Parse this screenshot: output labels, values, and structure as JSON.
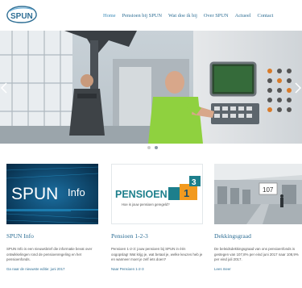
{
  "brand": {
    "logo_text": "SPUN"
  },
  "nav": {
    "items": [
      {
        "label": "Home",
        "active": true
      },
      {
        "label": "Pensioen bij SPUN",
        "active": false
      },
      {
        "label": "Wat doe ik bij",
        "active": false
      },
      {
        "label": "Over SPUN",
        "active": false
      },
      {
        "label": "Actueel",
        "active": false
      },
      {
        "label": "Contact",
        "active": false
      }
    ]
  },
  "slider": {
    "slides": 2,
    "active": 2
  },
  "cards": [
    {
      "title": "SPUN Info",
      "thumb_text": {
        "left": "SPUN",
        "right": "Info"
      },
      "body": "SPUN Info is een nieuwsbrief die informatie bevat over ontwikkelingen rond de pensioenregeling en het pensioenfonds.",
      "link": "Ga naar de nieuwste editie: juni 2017"
    },
    {
      "title": "Pensioen 1-2-3",
      "thumb_text": {
        "word": "PENSIOEN",
        "n1": "1",
        "n3": "3",
        "sub": "Hoe is jouw pensioen geregeld?"
      },
      "body": "Pensioen 1-2-3: jouw pensioen bij SPUN in één oogopslag! Wat krijg je, wat betaal je, welke keuzes heb je en wanneer moet je zelf iets doen?",
      "link": "Naar Pensioen 1-2-3"
    },
    {
      "title": "Dekkingsgraad",
      "thumb_text": {
        "sign": "107"
      },
      "body": "De beleidsdekkingsgraad van ons pensioenfonds is gestegen van 107,8% per eind juni 2017 naar 108,9% per eind juli 2017.",
      "link": "Lees meer"
    }
  ],
  "colors": {
    "brand": "#2f6f95",
    "accent": "#3a8bb8",
    "shirt": "#8fd13f"
  }
}
